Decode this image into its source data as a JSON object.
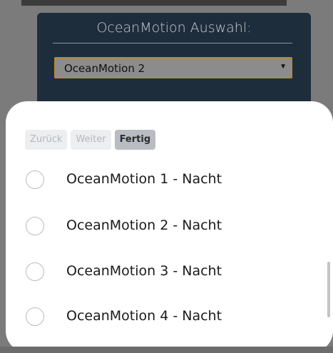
{
  "background": {
    "title": "OceanMotion Auswahl:",
    "select_value": "OceanMotion 2"
  },
  "picker": {
    "nav": {
      "back_label": "Zurück",
      "next_label": "Weiter",
      "done_label": "Fertig"
    },
    "options": [
      {
        "label": "OceanMotion 1 - Nacht"
      },
      {
        "label": "OceanMotion 2 - Nacht"
      },
      {
        "label": "OceanMotion 3 - Nacht"
      },
      {
        "label": "OceanMotion 4 - Nacht"
      }
    ]
  },
  "colors": {
    "panel": "#1e2d3b",
    "overlay": "#7b7b7b",
    "select_border": "#b98a2c"
  }
}
